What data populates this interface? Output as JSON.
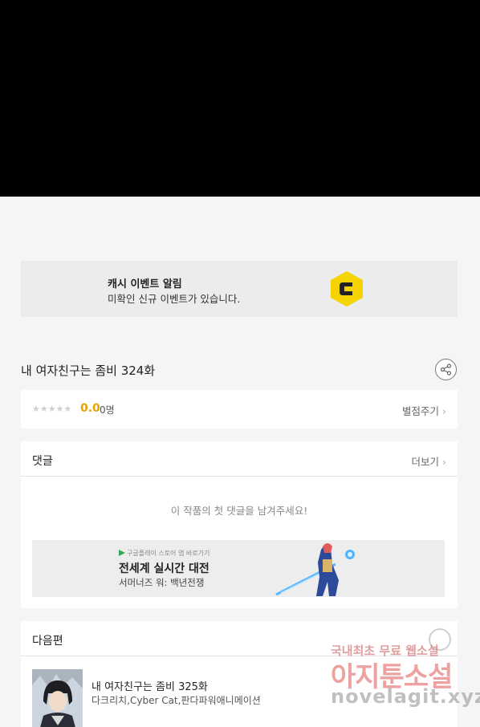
{
  "banner": {
    "title": "캐시 이벤트 알림",
    "subtitle": "미확인 신규 이벤트가 있습니다.",
    "icon": "c-coin-icon",
    "accent": "#f5d300"
  },
  "episode": {
    "title": "내 여자친구는 좀비 324화"
  },
  "rating": {
    "stars": "★★★★★",
    "score": "0.0",
    "count": "0명",
    "rate_label": "별점주기"
  },
  "comments": {
    "heading": "댓글",
    "more_label": "더보기",
    "empty_message": "이 작품의 첫 댓글을 남겨주세요!"
  },
  "ad": {
    "small_text": "구글플레이 스토어 앱 바로가기",
    "title": "전세계 실시간 대전",
    "subtitle": "서머너즈 워: 백년전쟁"
  },
  "next": {
    "heading": "다음편",
    "title": "내 여자친구는 좀비 325화",
    "authors": "다크리치,Cyber Cat,판다파워애니메이션"
  },
  "watermark": {
    "line1": "국내최초 무료 웹소설",
    "line2": "아지툰소설",
    "line3": "novelagit.xyz"
  }
}
